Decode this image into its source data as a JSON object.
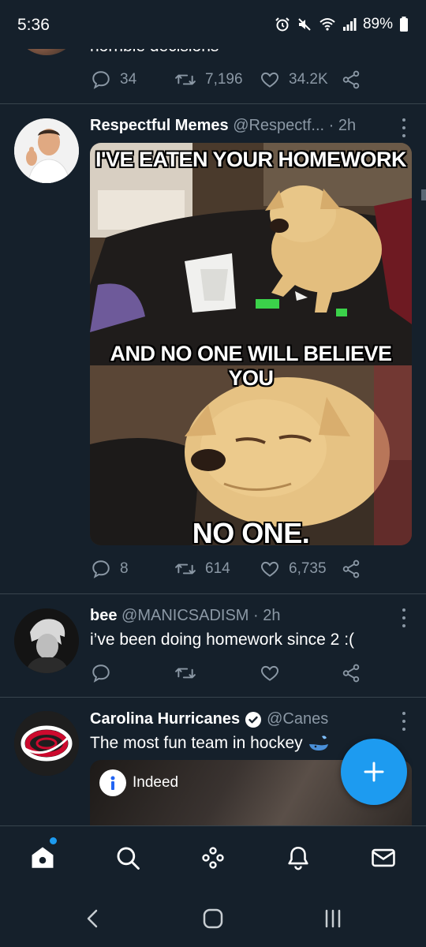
{
  "status_bar": {
    "time": "5:36",
    "battery": "89%"
  },
  "tweets": [
    {
      "text": "horrible decisions",
      "replies": "34",
      "retweets": "7,196",
      "likes": "34.2K"
    },
    {
      "name": "Respectful Memes",
      "handle": "@Respectf...",
      "time": "· 2h",
      "meme": {
        "caption_top": "I'VE EATEN YOUR HOMEWORK",
        "caption_middle": "AND NO ONE WILL BELIEVE YOU",
        "caption_bottom": "NO ONE."
      },
      "replies": "8",
      "retweets": "614",
      "likes": "6,735"
    },
    {
      "name": "bee",
      "handle": "@MANICSADISM",
      "time": "· 2h",
      "text": "i’ve been doing homework since 2  :("
    },
    {
      "name": "Carolina Hurricanes",
      "handle": "@Canes",
      "text": "The most fun team in hockey",
      "verified": true,
      "card": {
        "label": "Indeed"
      }
    }
  ],
  "colors": {
    "background": "#15202b",
    "accent": "#1d9bf0",
    "muted": "#8b98a5",
    "divider": "#38444d"
  },
  "nav": {
    "items": [
      "home-icon",
      "search-icon",
      "spaces-icon",
      "bell-icon",
      "mail-icon"
    ]
  }
}
